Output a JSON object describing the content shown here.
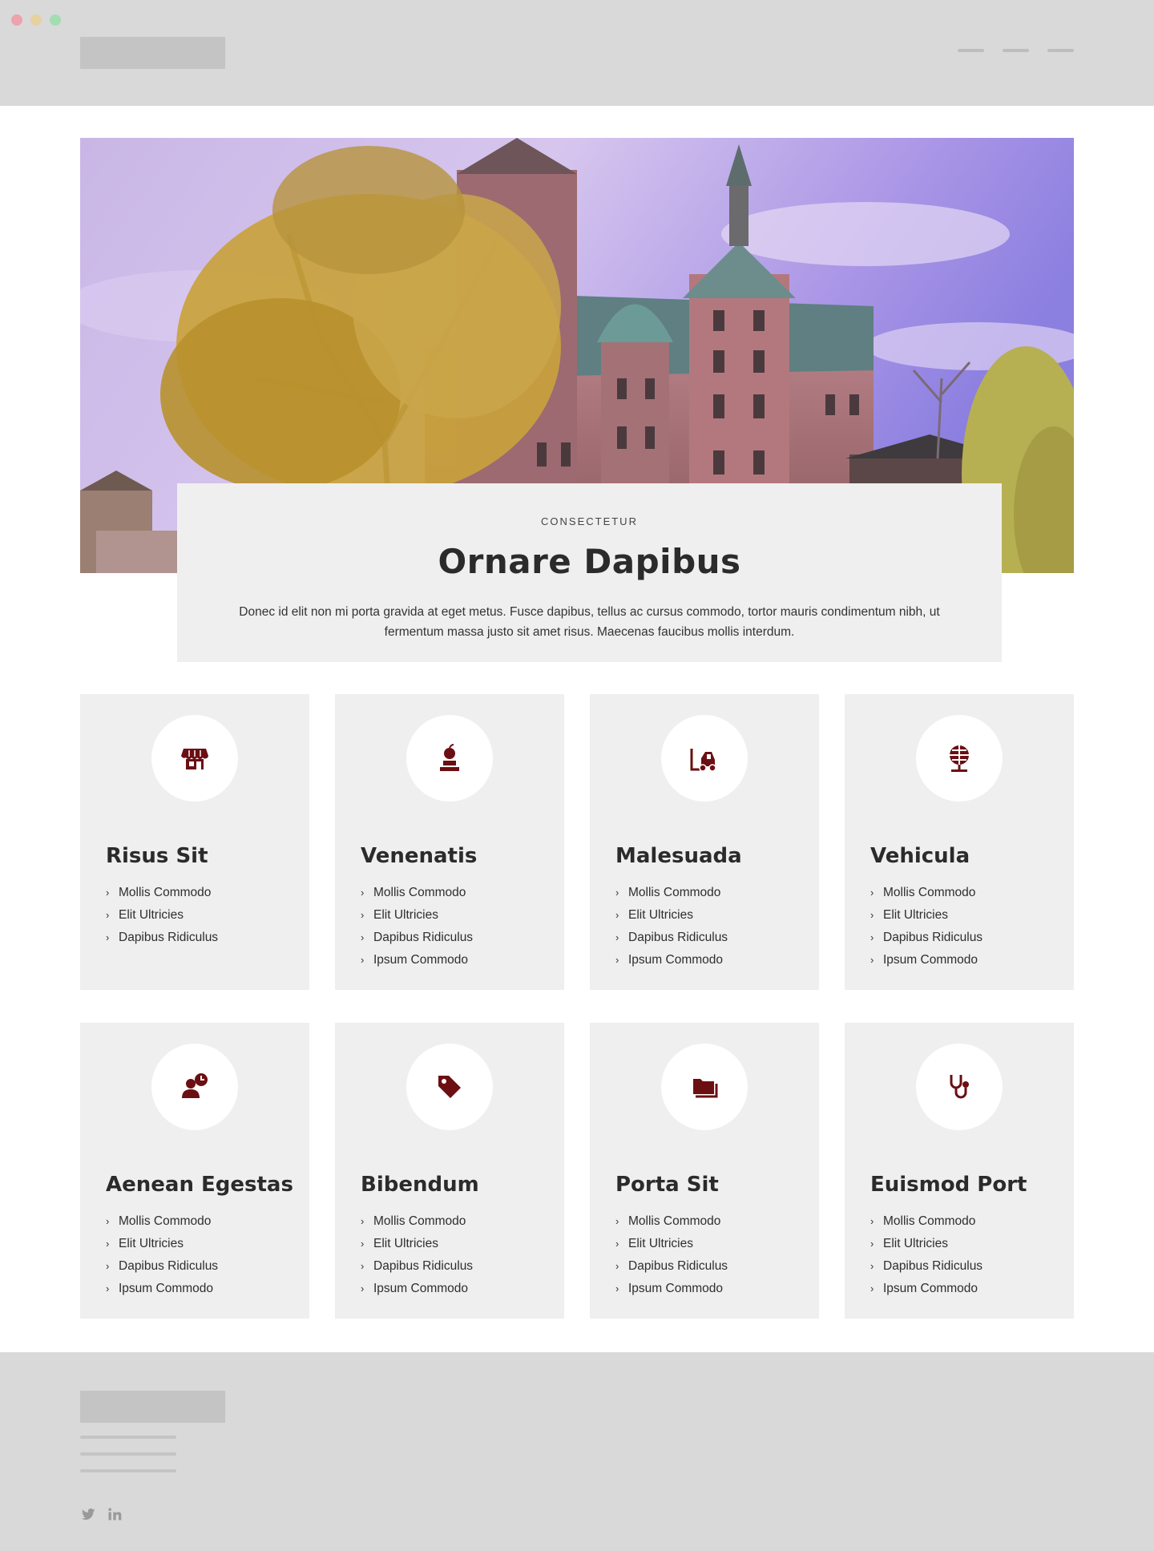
{
  "window": {
    "controls": [
      "close",
      "minimize",
      "zoom"
    ],
    "colors": {
      "close": "#eca3ad",
      "minimize": "#e6d2a0",
      "zoom": "#a4dcb3"
    }
  },
  "header": {
    "logo_placeholder": true,
    "nav_lines": 3
  },
  "hero": {
    "image": "castle-with-autumn-tree-photo"
  },
  "intro": {
    "eyebrow": "CONSECTETUR",
    "title": "Ornare Dapibus",
    "body": "Donec id elit non mi porta gravida at eget metus. Fusce dapibus, tellus ac cursus commodo, tortor mauris condimentum nibh, ut fermentum massa justo sit amet risus. Maecenas faucibus mollis interdum."
  },
  "colors": {
    "accent": "#6b0f13",
    "card_bg": "#efefef",
    "header_bg": "#d9d9d9"
  },
  "cards": [
    {
      "icon": "store-icon",
      "title": "Risus Sit",
      "items": [
        "Mollis Commodo",
        "Elit Ultricies",
        "Dapibus Ridiculus"
      ]
    },
    {
      "icon": "apple-scale-icon",
      "title": "Venenatis",
      "items": [
        "Mollis Commodo",
        "Elit Ultricies",
        "Dapibus Ridiculus",
        "Ipsum Commodo"
      ]
    },
    {
      "icon": "forklift-icon",
      "title": "Malesuada",
      "items": [
        "Mollis Commodo",
        "Elit Ultricies",
        "Dapibus Ridiculus",
        "Ipsum Commodo"
      ]
    },
    {
      "icon": "globe-stand-icon",
      "title": "Vehicula",
      "items": [
        "Mollis Commodo",
        "Elit Ultricies",
        "Dapibus Ridiculus",
        "Ipsum Commodo"
      ]
    },
    {
      "icon": "user-clock-icon",
      "title": "Aenean Egestas",
      "items": [
        "Mollis Commodo",
        "Elit Ultricies",
        "Dapibus Ridiculus",
        "Ipsum Commodo"
      ]
    },
    {
      "icon": "tags-icon",
      "title": "Bibendum",
      "items": [
        "Mollis Commodo",
        "Elit Ultricies",
        "Dapibus Ridiculus",
        "Ipsum Commodo"
      ]
    },
    {
      "icon": "folders-icon",
      "title": "Porta Sit",
      "items": [
        "Mollis Commodo",
        "Elit Ultricies",
        "Dapibus Ridiculus",
        "Ipsum Commodo"
      ]
    },
    {
      "icon": "stethoscope-icon",
      "title": "Euismod Port",
      "items": [
        "Mollis Commodo",
        "Elit Ultricies",
        "Dapibus Ridiculus",
        "Ipsum Commodo"
      ]
    }
  ],
  "footer": {
    "logo_placeholder": true,
    "lines": 3,
    "social": [
      "twitter-icon",
      "linkedin-icon"
    ]
  }
}
